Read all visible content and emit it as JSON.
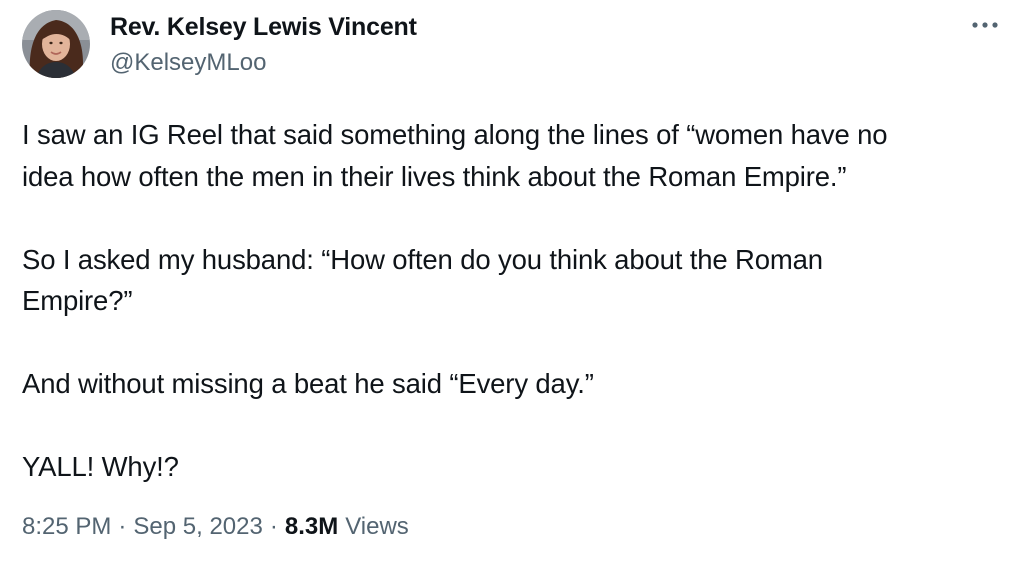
{
  "author": {
    "display_name": "Rev. Kelsey Lewis Vincent",
    "handle": "@KelseyMLoo"
  },
  "tweet": {
    "paragraphs": [
      "I saw an IG Reel that said something along the lines of “women have no\nidea how often the men in their lives think about the Roman Empire.”",
      "So I asked my husband: “How often do you think about the Roman\nEmpire?”",
      "And without missing a beat he said “Every day.”",
      "YALL! Why!?"
    ]
  },
  "meta": {
    "time": "8:25 PM",
    "date": "Sep 5, 2023",
    "separator": "·",
    "views_count": "8.3M",
    "views_label": "Views"
  },
  "icons": {
    "more": "more-horizontal-icon",
    "avatar": "profile-photo"
  },
  "colors": {
    "primary_text": "#0f1419",
    "secondary_text": "#536471",
    "background": "#ffffff"
  }
}
